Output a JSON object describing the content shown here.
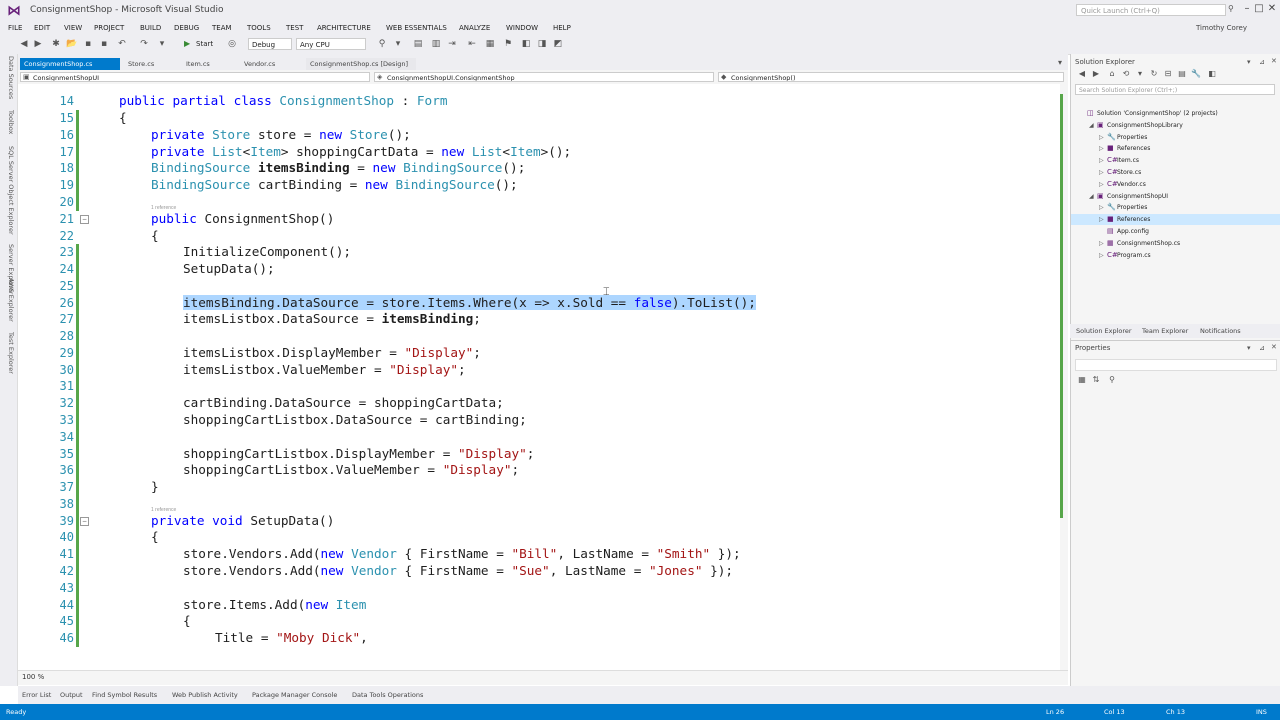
{
  "window": {
    "title": "ConsignmentShop - Microsoft Visual Studio",
    "quick_launch_placeholder": "Quick Launch (Ctrl+Q)",
    "user": "Timothy Corey"
  },
  "menu": [
    "FILE",
    "EDIT",
    "VIEW",
    "PROJECT",
    "BUILD",
    "DEBUG",
    "TEAM",
    "TOOLS",
    "TEST",
    "ARCHITECTURE",
    "WEB ESSENTIALS",
    "ANALYZE",
    "WINDOW",
    "HELP"
  ],
  "toolbar": {
    "start_label": "Start",
    "config": "Debug",
    "platform": "Any CPU"
  },
  "left_tabs": [
    "Data Sources",
    "Toolbox",
    "SQL Server Object Explorer",
    "Server Explorer",
    "AWS Explorer",
    "Test Explorer"
  ],
  "doc_tabs": [
    {
      "label": "ConsignmentShop.cs",
      "state": "active"
    },
    {
      "label": "Store.cs",
      "state": "normal"
    },
    {
      "label": "Item.cs",
      "state": "normal"
    },
    {
      "label": "Vendor.cs",
      "state": "normal"
    },
    {
      "label": "ConsignmentShop.cs [Design]",
      "state": "preview"
    }
  ],
  "nav_bar": {
    "project": "ConsignmentShopUI",
    "type": "ConsignmentShopUI.ConsignmentShop",
    "member": "ConsignmentShop()"
  },
  "editor": {
    "zoom": "100 %",
    "code_lens": "1 reference",
    "lines": [
      {
        "n": "14",
        "indent": 1,
        "tokens": [
          [
            "public partial class ",
            "kw"
          ],
          [
            "ConsignmentShop",
            "ty"
          ],
          [
            " : ",
            ""
          ],
          [
            "Form",
            "ty"
          ]
        ]
      },
      {
        "n": "15",
        "indent": 1,
        "tokens": [
          [
            "{",
            ""
          ]
        ]
      },
      {
        "n": "16",
        "indent": 2,
        "tokens": [
          [
            "private ",
            "kw"
          ],
          [
            "Store",
            "ty"
          ],
          [
            " store = ",
            ""
          ],
          [
            "new ",
            "kw"
          ],
          [
            "Store",
            "ty"
          ],
          [
            "();",
            ""
          ]
        ]
      },
      {
        "n": "17",
        "indent": 2,
        "tokens": [
          [
            "private ",
            "kw"
          ],
          [
            "List",
            "ty"
          ],
          [
            "<",
            ""
          ],
          [
            "Item",
            "ty"
          ],
          [
            "> shoppingCartData = ",
            ""
          ],
          [
            "new ",
            "kw"
          ],
          [
            "List",
            "ty"
          ],
          [
            "<",
            ""
          ],
          [
            "Item",
            "ty"
          ],
          [
            ">();",
            ""
          ]
        ]
      },
      {
        "n": "18",
        "indent": 2,
        "tokens": [
          [
            "BindingSource",
            "ty"
          ],
          [
            " ",
            ""
          ],
          [
            "itemsBinding",
            "b"
          ],
          [
            " = ",
            ""
          ],
          [
            "new ",
            "kw"
          ],
          [
            "BindingSource",
            "ty"
          ],
          [
            "();",
            ""
          ]
        ]
      },
      {
        "n": "19",
        "indent": 2,
        "tokens": [
          [
            "BindingSource",
            "ty"
          ],
          [
            " cartBinding = ",
            ""
          ],
          [
            "new ",
            "kw"
          ],
          [
            "BindingSource",
            "ty"
          ],
          [
            "();",
            ""
          ]
        ]
      },
      {
        "n": "20",
        "indent": 0,
        "tokens": []
      },
      {
        "n": "21",
        "indent": 2,
        "tokens": [
          [
            "public ",
            "kw"
          ],
          [
            "ConsignmentShop()",
            ""
          ]
        ]
      },
      {
        "n": "22",
        "indent": 2,
        "tokens": [
          [
            "{",
            ""
          ]
        ]
      },
      {
        "n": "23",
        "indent": 3,
        "tokens": [
          [
            "InitializeComponent();",
            ""
          ]
        ]
      },
      {
        "n": "24",
        "indent": 3,
        "tokens": [
          [
            "SetupData();",
            ""
          ]
        ]
      },
      {
        "n": "25",
        "indent": 0,
        "tokens": []
      },
      {
        "n": "26",
        "indent": 3,
        "tokens": [
          [
            "itemsBinding.DataSource = store.Items.Where(x => x.Sold == ",
            "hl"
          ],
          [
            "false",
            "hlkw"
          ],
          [
            ").ToList();",
            "hl"
          ]
        ]
      },
      {
        "n": "27",
        "indent": 3,
        "tokens": [
          [
            "itemsListbox.DataSource = ",
            ""
          ],
          [
            "itemsBinding",
            "b"
          ],
          [
            ";",
            ""
          ]
        ]
      },
      {
        "n": "28",
        "indent": 0,
        "tokens": []
      },
      {
        "n": "29",
        "indent": 3,
        "tokens": [
          [
            "itemsListbox.DisplayMember = ",
            ""
          ],
          [
            "\"Display\"",
            "st"
          ],
          [
            ";",
            ""
          ]
        ]
      },
      {
        "n": "30",
        "indent": 3,
        "tokens": [
          [
            "itemsListbox.ValueMember = ",
            ""
          ],
          [
            "\"Display\"",
            "st"
          ],
          [
            ";",
            ""
          ]
        ]
      },
      {
        "n": "31",
        "indent": 0,
        "tokens": []
      },
      {
        "n": "32",
        "indent": 3,
        "tokens": [
          [
            "cartBinding.DataSource = shoppingCartData;",
            ""
          ]
        ]
      },
      {
        "n": "33",
        "indent": 3,
        "tokens": [
          [
            "shoppingCartListbox.DataSource = cartBinding;",
            ""
          ]
        ]
      },
      {
        "n": "34",
        "indent": 0,
        "tokens": []
      },
      {
        "n": "35",
        "indent": 3,
        "tokens": [
          [
            "shoppingCartListbox.DisplayMember = ",
            ""
          ],
          [
            "\"Display\"",
            "st"
          ],
          [
            ";",
            ""
          ]
        ]
      },
      {
        "n": "36",
        "indent": 3,
        "tokens": [
          [
            "shoppingCartListbox.ValueMember = ",
            ""
          ],
          [
            "\"Display\"",
            "st"
          ],
          [
            ";",
            ""
          ]
        ]
      },
      {
        "n": "37",
        "indent": 2,
        "tokens": [
          [
            "}",
            ""
          ]
        ]
      },
      {
        "n": "38",
        "indent": 0,
        "tokens": []
      },
      {
        "n": "39",
        "indent": 2,
        "tokens": [
          [
            "private void ",
            "kw"
          ],
          [
            "SetupData()",
            ""
          ]
        ]
      },
      {
        "n": "40",
        "indent": 2,
        "tokens": [
          [
            "{",
            ""
          ]
        ]
      },
      {
        "n": "41",
        "indent": 3,
        "tokens": [
          [
            "store.Vendors.Add(",
            ""
          ],
          [
            "new ",
            "kw"
          ],
          [
            "Vendor",
            "ty"
          ],
          [
            " { FirstName = ",
            ""
          ],
          [
            "\"Bill\"",
            "st"
          ],
          [
            ", LastName = ",
            ""
          ],
          [
            "\"Smith\"",
            "st"
          ],
          [
            " });",
            ""
          ]
        ]
      },
      {
        "n": "42",
        "indent": 3,
        "tokens": [
          [
            "store.Vendors.Add(",
            ""
          ],
          [
            "new ",
            "kw"
          ],
          [
            "Vendor",
            "ty"
          ],
          [
            " { FirstName = ",
            ""
          ],
          [
            "\"Sue\"",
            "st"
          ],
          [
            ", LastName = ",
            ""
          ],
          [
            "\"Jones\"",
            "st"
          ],
          [
            " });",
            ""
          ]
        ]
      },
      {
        "n": "43",
        "indent": 0,
        "tokens": []
      },
      {
        "n": "44",
        "indent": 3,
        "tokens": [
          [
            "store.Items.Add(",
            ""
          ],
          [
            "new ",
            "kw"
          ],
          [
            "Item",
            "ty"
          ]
        ]
      },
      {
        "n": "45",
        "indent": 3,
        "tokens": [
          [
            "{",
            ""
          ]
        ]
      },
      {
        "n": "46",
        "indent": 4,
        "tokens": [
          [
            "Title = ",
            ""
          ],
          [
            "\"Moby Dick\"",
            "st"
          ],
          [
            ",",
            ""
          ]
        ]
      }
    ]
  },
  "solution_explorer": {
    "title": "Solution Explorer",
    "search_placeholder": "Search Solution Explorer (Ctrl+;)",
    "rows": [
      {
        "label": "Solution 'ConsignmentShop' (2 projects)",
        "depth": 0,
        "arrow": "",
        "icon": "◫",
        "sel": false
      },
      {
        "label": "ConsignmentShopLibrary",
        "depth": 1,
        "arrow": "◢",
        "icon": "▣",
        "sel": false
      },
      {
        "label": "Properties",
        "depth": 2,
        "arrow": "▷",
        "icon": "🔧",
        "sel": false
      },
      {
        "label": "References",
        "depth": 2,
        "arrow": "▷",
        "icon": "■",
        "sel": false
      },
      {
        "label": "Item.cs",
        "depth": 2,
        "arrow": "▷",
        "icon": "C#",
        "sel": false
      },
      {
        "label": "Store.cs",
        "depth": 2,
        "arrow": "▷",
        "icon": "C#",
        "sel": false
      },
      {
        "label": "Vendor.cs",
        "depth": 2,
        "arrow": "▷",
        "icon": "C#",
        "sel": false
      },
      {
        "label": "ConsignmentShopUI",
        "depth": 1,
        "arrow": "◢",
        "icon": "▣",
        "sel": false
      },
      {
        "label": "Properties",
        "depth": 2,
        "arrow": "▷",
        "icon": "🔧",
        "sel": false
      },
      {
        "label": "References",
        "depth": 2,
        "arrow": "▷",
        "icon": "■",
        "sel": true
      },
      {
        "label": "App.config",
        "depth": 2,
        "arrow": "",
        "icon": "▤",
        "sel": false
      },
      {
        "label": "ConsignmentShop.cs",
        "depth": 2,
        "arrow": "▷",
        "icon": "▦",
        "sel": false
      },
      {
        "label": "Program.cs",
        "depth": 2,
        "arrow": "▷",
        "icon": "C#",
        "sel": false
      }
    ],
    "bottom_tabs": [
      "Solution Explorer",
      "Team Explorer",
      "Notifications"
    ]
  },
  "properties": {
    "title": "Properties"
  },
  "bottom_tabs": [
    "Error List",
    "Output",
    "Find Symbol Results",
    "Web Publish Activity",
    "Package Manager Console",
    "Data Tools Operations"
  ],
  "status": {
    "ready": "Ready",
    "ln": "Ln 26",
    "col": "Col 13",
    "ch": "Ch 13",
    "ins": "INS"
  },
  "colors": {
    "accent": "#007acc",
    "keyword": "#0000ff",
    "type": "#2b91af",
    "string": "#a31515",
    "selection": "#add6ff",
    "change_marker": "#57a64a"
  }
}
